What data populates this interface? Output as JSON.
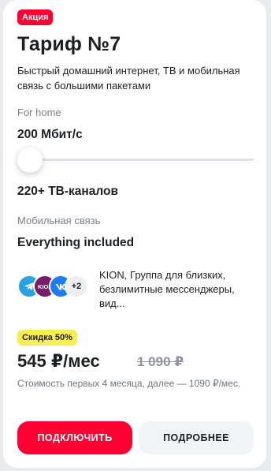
{
  "card": {
    "badge": "Акция",
    "title": "Тариф №7",
    "description": "Быстрый домашний интернет, ТВ и мобильная связь с большими пакетами"
  },
  "home": {
    "label": "For home",
    "speed": "200 Мбит/с",
    "slider_level": 0
  },
  "tv": {
    "channels": "220+ ТВ-каналов"
  },
  "mobile": {
    "label": "Мобильная связь",
    "value": "Everything included",
    "apps": [
      "telegram-icon",
      "kion-icon",
      "vk-icon"
    ],
    "apps_more": "+2",
    "apps_text": "KION, Группа для близких, безлимитные мессенджеры, вид..."
  },
  "pricing": {
    "discount": "Скидка 50%",
    "price": "545 ₽/мес",
    "old_price": "1 090 ₽",
    "note": "Стоимость первых 4 месяца, далее — 1090 ₽/мес."
  },
  "actions": {
    "connect": "ПОДКЛЮЧИТЬ",
    "details": "ПОДРОБНЕЕ"
  },
  "colors": {
    "brand_red": "#ff0032",
    "discount_yellow": "#f8ee4f",
    "telegram": "#2aa1e2",
    "kion": "#7a1b6b",
    "vk": "#1c7cf0"
  }
}
